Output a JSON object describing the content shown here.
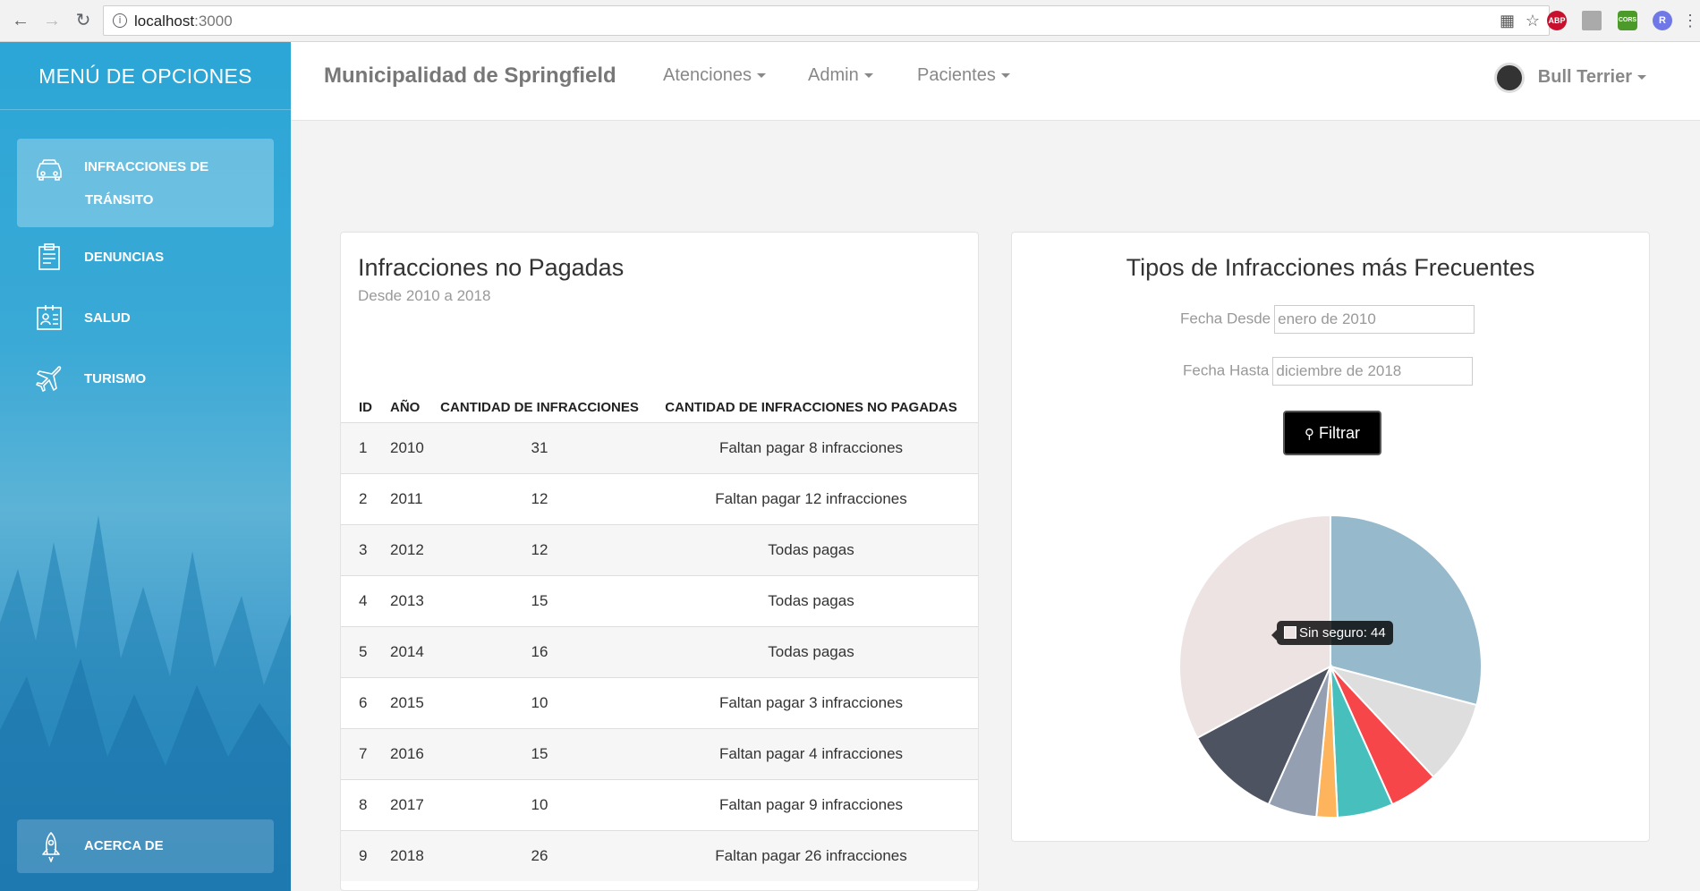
{
  "browser": {
    "url_host": "localhost",
    "url_port": ":3000",
    "extensions": [
      "ABP",
      "CORS",
      "R"
    ]
  },
  "sidebar": {
    "title": "MENÚ DE OPCIONES",
    "items": [
      {
        "label_line1": "INFRACCIONES DE",
        "label_line2": "TRÁNSITO",
        "icon": "car-icon"
      },
      {
        "label": "DENUNCIAS",
        "icon": "clipboard-icon"
      },
      {
        "label": "SALUD",
        "icon": "id-card-icon"
      },
      {
        "label": "TURISMO",
        "icon": "airplane-icon"
      }
    ],
    "about_label": "ACERCA DE"
  },
  "navbar": {
    "brand": "Municipalidad de Springfield",
    "menus": [
      "Atenciones",
      "Admin",
      "Pacientes"
    ],
    "user": "Bull Terrier"
  },
  "table_card": {
    "title": "Infracciones no Pagadas",
    "subtitle": "Desde 2010 a 2018",
    "headers": [
      "ID",
      "AÑO",
      "CANTIDAD DE INFRACCIONES",
      "CANTIDAD DE INFRACCIONES NO PAGADAS"
    ],
    "rows": [
      {
        "id": "1",
        "year": "2010",
        "count": "31",
        "unpaid": "Faltan pagar 8 infracciones"
      },
      {
        "id": "2",
        "year": "2011",
        "count": "12",
        "unpaid": "Faltan pagar 12 infracciones"
      },
      {
        "id": "3",
        "year": "2012",
        "count": "12",
        "unpaid": "Todas pagas"
      },
      {
        "id": "4",
        "year": "2013",
        "count": "15",
        "unpaid": "Todas pagas"
      },
      {
        "id": "5",
        "year": "2014",
        "count": "16",
        "unpaid": "Todas pagas"
      },
      {
        "id": "6",
        "year": "2015",
        "count": "10",
        "unpaid": "Faltan pagar 3 infracciones"
      },
      {
        "id": "7",
        "year": "2016",
        "count": "15",
        "unpaid": "Faltan pagar 4 infracciones"
      },
      {
        "id": "8",
        "year": "2017",
        "count": "10",
        "unpaid": "Faltan pagar 9 infracciones"
      },
      {
        "id": "9",
        "year": "2018",
        "count": "26",
        "unpaid": "Faltan pagar 26 infracciones"
      }
    ]
  },
  "chart_card": {
    "title": "Tipos de Infracciones más Frecuentes",
    "from_label": "Fecha Desde",
    "from_value": "enero de 2010",
    "to_label": "Fecha Hasta",
    "to_value": "diciembre de 2018",
    "filter_label": "Filtrar",
    "tooltip": "Sin seguro: 44"
  },
  "chart_data": {
    "type": "pie",
    "slices": [
      {
        "value": 39,
        "color": "#97b9cc"
      },
      {
        "value": 12,
        "color": "#dedede"
      },
      {
        "value": 7,
        "color": "#f7464a"
      },
      {
        "value": 8,
        "color": "#46bfbd"
      },
      {
        "value": 3,
        "color": "#fdb45c"
      },
      {
        "value": 7,
        "color": "#949fb1"
      },
      {
        "value": 14,
        "color": "#4d5360"
      },
      {
        "name": "Sin seguro",
        "value": 44,
        "color": "#ede3e3"
      }
    ]
  }
}
